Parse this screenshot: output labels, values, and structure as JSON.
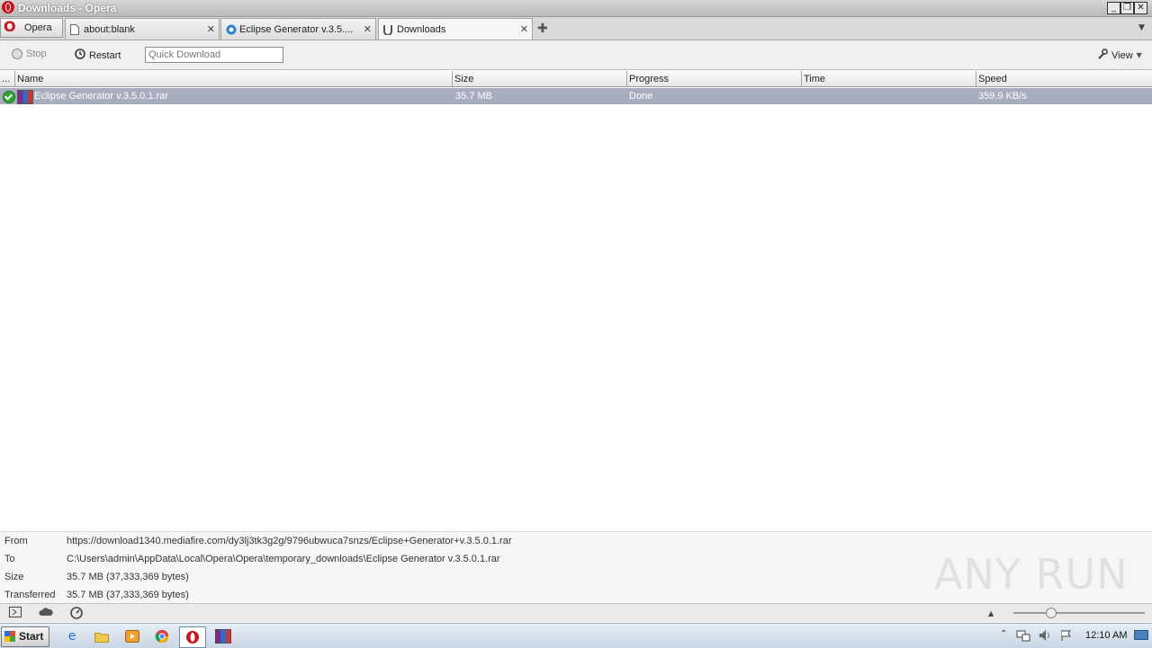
{
  "window": {
    "title": "Downloads - Opera",
    "minimize_glyph": "_",
    "maximize_glyph": "❒",
    "close_glyph": "✕"
  },
  "menu_button": {
    "label": "Opera"
  },
  "tabs": [
    {
      "label": "about:blank",
      "icon": "page-icon"
    },
    {
      "label": "Eclipse Generator v.3.5....",
      "icon": "browser-icon"
    },
    {
      "label": "Downloads",
      "icon": "download-icon",
      "active": true
    }
  ],
  "tab_close_glyph": "✕",
  "add_tab_glyph": "✚",
  "tab_menu_glyph": "▼",
  "toolbar": {
    "stop_label": "Stop",
    "restart_label": "Restart",
    "quick_download_placeholder": "Quick Download",
    "view_label": "View"
  },
  "columns": [
    "...",
    "Name",
    "Size",
    "Progress",
    "Time",
    "Speed"
  ],
  "downloads": [
    {
      "name": "Eclipse Generator v.3.5.0.1.rar",
      "size": "35.7 MB",
      "progress": "Done",
      "time": "",
      "speed": "359.9 KB/s",
      "status": "completed",
      "file_icon": "rar-archive-icon"
    }
  ],
  "details": {
    "from_label": "From",
    "from_value": "https://download1340.mediafire.com/dy3lj3tk3g2g/9796ubwuca7snzs/Eclipse+Generator+v.3.5.0.1.rar",
    "to_label": "To",
    "to_value": "C:\\Users\\admin\\AppData\\Local\\Opera\\Opera\\temporary_downloads\\Eclipse Generator v.3.5.0.1.rar",
    "size_label": "Size",
    "size_value": "35.7 MB (37,333,369 bytes)",
    "transferred_label": "Transferred",
    "transferred_value": "35.7 MB (37,333,369 bytes)"
  },
  "watermark": "ANY RUN",
  "statusbar": {
    "zoom_fraction": 0.28
  },
  "taskbar": {
    "start_label": "Start",
    "clock": "12:10 AM",
    "apps": [
      "internet-explorer-icon",
      "folder-icon",
      "media-player-icon",
      "chrome-icon",
      "opera-icon",
      "winrar-icon"
    ]
  },
  "colors": {
    "accent": "#c8141a",
    "selected_row": "#a8acbf",
    "check": "#2fa62f"
  }
}
